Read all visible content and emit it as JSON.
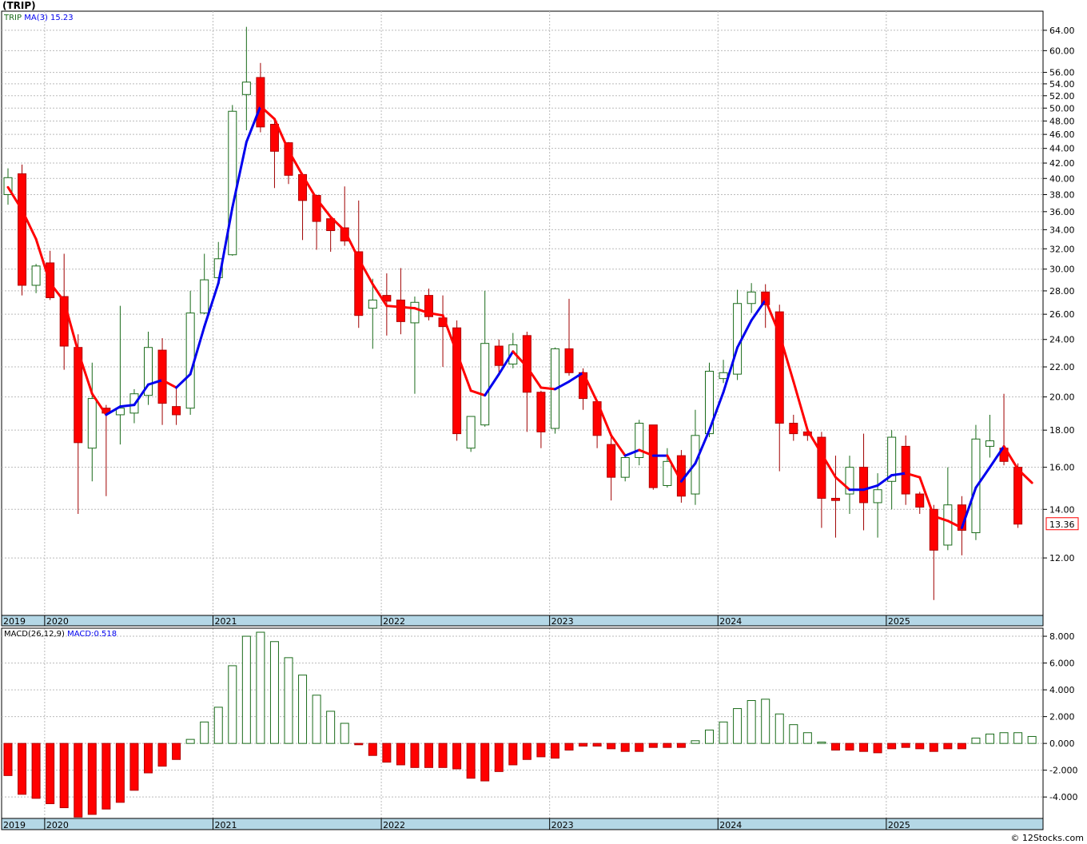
{
  "page": {
    "title": "(TRIP)",
    "credit": "© 12Stocks.com"
  },
  "chart_data": [
    {
      "type": "candlestick",
      "ticker": "TRIP",
      "legend": {
        "ticker_label": "TRIP",
        "ma_label": "MA(3)",
        "ma_value": "15.23"
      },
      "last_price_label": "13.36",
      "colors": {
        "up": "#1a6b1a",
        "down": "#ff0000",
        "ma_up": "#0000ee",
        "ma_down": "#ff0000",
        "axis_bar": "#b4d7e6",
        "grid": "#bbbbbb"
      },
      "y_scale": "log",
      "ylim": [
        10.0,
        68.0
      ],
      "y_ticks": [
        12,
        14,
        16,
        18,
        20,
        22,
        24,
        26,
        28,
        30,
        32,
        34,
        36,
        38,
        40,
        42,
        44,
        46,
        48,
        50,
        52,
        54,
        56,
        60,
        64
      ],
      "y_tick_labels": [
        "12.00",
        "14.00",
        "16.00",
        "18.00",
        "20.00",
        "22.00",
        "24.00",
        "26.00",
        "28.00",
        "30.00",
        "32.00",
        "34.00",
        "36.00",
        "38.00",
        "40.00",
        "42.00",
        "44.00",
        "46.00",
        "48.00",
        "50.00",
        "52.00",
        "54.00",
        "56.00",
        "60.00",
        "64.00"
      ],
      "x_labels": [
        "2019",
        "2020",
        "2021",
        "2022",
        "2023",
        "2024",
        "2025"
      ],
      "x_label_month_index": [
        0,
        3,
        15,
        27,
        39,
        51,
        63
      ],
      "months": [
        "2019-10",
        "2019-11",
        "2019-12",
        "2020-01",
        "2020-02",
        "2020-03",
        "2020-04",
        "2020-05",
        "2020-06",
        "2020-07",
        "2020-08",
        "2020-09",
        "2020-10",
        "2020-11",
        "2020-12",
        "2021-01",
        "2021-02",
        "2021-03",
        "2021-04",
        "2021-05",
        "2021-06",
        "2021-07",
        "2021-08",
        "2021-09",
        "2021-10",
        "2021-11",
        "2021-12",
        "2022-01",
        "2022-02",
        "2022-03",
        "2022-04",
        "2022-05",
        "2022-06",
        "2022-07",
        "2022-08",
        "2022-09",
        "2022-10",
        "2022-11",
        "2022-12",
        "2023-01",
        "2023-02",
        "2023-03",
        "2023-04",
        "2023-05",
        "2023-06",
        "2023-07",
        "2023-08",
        "2023-09",
        "2023-10",
        "2023-11",
        "2023-12",
        "2024-01",
        "2024-02",
        "2024-03",
        "2024-04",
        "2024-05",
        "2024-06",
        "2024-07",
        "2024-08",
        "2024-09",
        "2024-10",
        "2024-11",
        "2024-12",
        "2025-01",
        "2025-02",
        "2025-03",
        "2025-04",
        "2025-05",
        "2025-06",
        "2025-07",
        "2025-08",
        "2025-09",
        "2025-10"
      ],
      "candles": [
        {
          "o": 38.0,
          "h": 41.3,
          "l": 36.8,
          "c": 40.1
        },
        {
          "o": 40.6,
          "h": 41.8,
          "l": 27.6,
          "c": 28.5
        },
        {
          "o": 28.5,
          "h": 30.5,
          "l": 27.8,
          "c": 30.3
        },
        {
          "o": 30.6,
          "h": 31.8,
          "l": 27.2,
          "c": 27.4
        },
        {
          "o": 27.5,
          "h": 31.5,
          "l": 21.8,
          "c": 23.5
        },
        {
          "o": 23.4,
          "h": 24.4,
          "l": 13.8,
          "c": 17.3
        },
        {
          "o": 17.0,
          "h": 22.3,
          "l": 15.3,
          "c": 19.9
        },
        {
          "o": 19.3,
          "h": 19.5,
          "l": 14.6,
          "c": 19.0
        },
        {
          "o": 18.9,
          "h": 26.7,
          "l": 17.2,
          "c": 19.3
        },
        {
          "o": 19.0,
          "h": 20.5,
          "l": 18.4,
          "c": 20.2
        },
        {
          "o": 20.1,
          "h": 24.6,
          "l": 19.5,
          "c": 23.4
        },
        {
          "o": 23.2,
          "h": 24.1,
          "l": 18.3,
          "c": 19.6
        },
        {
          "o": 19.4,
          "h": 20.7,
          "l": 18.3,
          "c": 18.9
        },
        {
          "o": 19.3,
          "h": 28.0,
          "l": 18.9,
          "c": 26.1
        },
        {
          "o": 26.1,
          "h": 31.5,
          "l": 26.0,
          "c": 29.0
        },
        {
          "o": 29.2,
          "h": 32.7,
          "l": 28.7,
          "c": 31.0
        },
        {
          "o": 31.4,
          "h": 50.5,
          "l": 31.3,
          "c": 49.5
        },
        {
          "o": 52.2,
          "h": 64.7,
          "l": 46.6,
          "c": 54.3
        },
        {
          "o": 55.1,
          "h": 57.7,
          "l": 46.3,
          "c": 47.1
        },
        {
          "o": 47.5,
          "h": 48.5,
          "l": 38.8,
          "c": 43.6
        },
        {
          "o": 44.8,
          "h": 44.9,
          "l": 39.3,
          "c": 40.4
        },
        {
          "o": 40.5,
          "h": 40.7,
          "l": 32.9,
          "c": 37.3
        },
        {
          "o": 37.9,
          "h": 38.0,
          "l": 31.9,
          "c": 34.9
        },
        {
          "o": 35.2,
          "h": 35.3,
          "l": 31.7,
          "c": 33.9
        },
        {
          "o": 34.2,
          "h": 39.0,
          "l": 32.3,
          "c": 32.8
        },
        {
          "o": 31.7,
          "h": 37.3,
          "l": 24.9,
          "c": 25.9
        },
        {
          "o": 26.5,
          "h": 29.1,
          "l": 23.3,
          "c": 27.2
        },
        {
          "o": 27.6,
          "h": 29.6,
          "l": 24.3,
          "c": 27.1
        },
        {
          "o": 27.2,
          "h": 30.1,
          "l": 24.4,
          "c": 25.4
        },
        {
          "o": 25.3,
          "h": 27.5,
          "l": 20.2,
          "c": 27.0
        },
        {
          "o": 27.6,
          "h": 28.2,
          "l": 25.5,
          "c": 25.8
        },
        {
          "o": 25.7,
          "h": 27.6,
          "l": 22.0,
          "c": 25.0
        },
        {
          "o": 24.9,
          "h": 25.5,
          "l": 17.4,
          "c": 17.8
        },
        {
          "o": 17.0,
          "h": 18.8,
          "l": 16.8,
          "c": 18.8
        },
        {
          "o": 18.3,
          "h": 28.0,
          "l": 18.2,
          "c": 23.7
        },
        {
          "o": 23.5,
          "h": 24.0,
          "l": 21.5,
          "c": 22.1
        },
        {
          "o": 22.2,
          "h": 24.5,
          "l": 21.9,
          "c": 23.6
        },
        {
          "o": 24.3,
          "h": 24.6,
          "l": 17.9,
          "c": 20.3
        },
        {
          "o": 20.3,
          "h": 20.4,
          "l": 17.0,
          "c": 17.9
        },
        {
          "o": 18.1,
          "h": 23.4,
          "l": 17.8,
          "c": 23.3
        },
        {
          "o": 23.3,
          "h": 27.3,
          "l": 21.4,
          "c": 21.6
        },
        {
          "o": 21.6,
          "h": 21.9,
          "l": 19.2,
          "c": 19.9
        },
        {
          "o": 19.7,
          "h": 19.8,
          "l": 17.0,
          "c": 17.7
        },
        {
          "o": 17.2,
          "h": 17.8,
          "l": 14.4,
          "c": 15.5
        },
        {
          "o": 15.5,
          "h": 16.7,
          "l": 15.3,
          "c": 16.5
        },
        {
          "o": 16.5,
          "h": 18.6,
          "l": 16.1,
          "c": 18.4
        },
        {
          "o": 18.3,
          "h": 18.3,
          "l": 14.9,
          "c": 15.0
        },
        {
          "o": 15.1,
          "h": 17.0,
          "l": 15.0,
          "c": 16.3
        },
        {
          "o": 16.6,
          "h": 16.9,
          "l": 14.3,
          "c": 14.6
        },
        {
          "o": 14.7,
          "h": 19.2,
          "l": 14.2,
          "c": 17.7
        },
        {
          "o": 17.8,
          "h": 22.3,
          "l": 17.6,
          "c": 21.7
        },
        {
          "o": 21.2,
          "h": 22.5,
          "l": 20.9,
          "c": 21.6
        },
        {
          "o": 21.5,
          "h": 28.1,
          "l": 21.1,
          "c": 26.9
        },
        {
          "o": 26.9,
          "h": 28.7,
          "l": 26.1,
          "c": 27.9
        },
        {
          "o": 27.9,
          "h": 28.6,
          "l": 24.9,
          "c": 26.8
        },
        {
          "o": 26.2,
          "h": 26.8,
          "l": 15.8,
          "c": 18.4
        },
        {
          "o": 18.4,
          "h": 18.9,
          "l": 17.4,
          "c": 17.8
        },
        {
          "o": 17.9,
          "h": 18.1,
          "l": 17.4,
          "c": 17.7
        },
        {
          "o": 17.6,
          "h": 17.9,
          "l": 13.2,
          "c": 14.5
        },
        {
          "o": 14.5,
          "h": 16.6,
          "l": 12.8,
          "c": 14.4
        },
        {
          "o": 14.7,
          "h": 16.6,
          "l": 13.8,
          "c": 16.0
        },
        {
          "o": 16.0,
          "h": 17.8,
          "l": 13.1,
          "c": 14.3
        },
        {
          "o": 14.3,
          "h": 15.7,
          "l": 12.8,
          "c": 14.9
        },
        {
          "o": 15.3,
          "h": 18.0,
          "l": 14.0,
          "c": 17.6
        },
        {
          "o": 17.1,
          "h": 17.7,
          "l": 14.2,
          "c": 14.7
        },
        {
          "o": 14.7,
          "h": 14.8,
          "l": 13.8,
          "c": 14.1
        },
        {
          "o": 14.0,
          "h": 14.2,
          "l": 10.5,
          "c": 12.3
        },
        {
          "o": 12.5,
          "h": 16.0,
          "l": 12.3,
          "c": 14.2
        },
        {
          "o": 14.2,
          "h": 14.6,
          "l": 12.1,
          "c": 13.1
        },
        {
          "o": 13.0,
          "h": 18.3,
          "l": 12.7,
          "c": 17.5
        },
        {
          "o": 17.1,
          "h": 18.9,
          "l": 16.5,
          "c": 17.4
        },
        {
          "o": 17.0,
          "h": 20.2,
          "l": 16.1,
          "c": 16.3
        },
        {
          "o": 16.0,
          "h": 16.2,
          "l": 13.2,
          "c": 13.36
        }
      ],
      "ma3": [
        38.9,
        36.2,
        33.0,
        28.7,
        27.1,
        23.1,
        20.2,
        18.9,
        19.4,
        19.5,
        20.8,
        21.1,
        20.6,
        21.5,
        25.0,
        28.7,
        36.5,
        44.9,
        50.3,
        48.3,
        43.7,
        40.4,
        37.5,
        35.4,
        33.9,
        31.0,
        28.6,
        26.7,
        26.6,
        26.5,
        26.1,
        25.9,
        23.0,
        20.4,
        20.1,
        21.5,
        23.1,
        22.0,
        20.6,
        20.5,
        21.0,
        21.6,
        19.7,
        17.7,
        16.6,
        16.9,
        16.6,
        16.6,
        15.3,
        16.2,
        18.0,
        20.3,
        23.4,
        25.5,
        27.2,
        24.4,
        21.0,
        18.0,
        16.7,
        15.5,
        14.9,
        14.9,
        15.1,
        15.6,
        15.7,
        15.5,
        13.7,
        13.5,
        13.2,
        15.0,
        16.0,
        17.1,
        15.9,
        15.23
      ],
      "ma3_note": "rendered as trend-colored line",
      "ma3_trend": [],
      "sub_chart": {
        "type": "histogram",
        "legend": {
          "label": "MACD(26,12,9)",
          "value_label": "MACD:0.518"
        },
        "ylim": [
          -5.6,
          8.6
        ],
        "y_ticks": [
          -4,
          -2,
          0,
          2,
          4,
          6,
          8
        ],
        "y_tick_labels": [
          "-4.000",
          "-2.000",
          "0.000",
          "2.000",
          "4.000",
          "6.000",
          "8.000"
        ],
        "values": [
          -2.4,
          -3.8,
          -4.1,
          -4.5,
          -4.8,
          -5.5,
          -5.3,
          -4.9,
          -4.4,
          -3.5,
          -2.2,
          -1.7,
          -1.2,
          0.3,
          1.6,
          2.7,
          5.8,
          8.0,
          8.3,
          7.6,
          6.4,
          5.1,
          3.6,
          2.4,
          1.5,
          -0.1,
          -0.9,
          -1.4,
          -1.6,
          -1.8,
          -1.8,
          -1.8,
          -1.9,
          -2.6,
          -2.8,
          -2.1,
          -1.6,
          -1.2,
          -1.0,
          -1.1,
          -0.5,
          -0.2,
          -0.2,
          -0.4,
          -0.6,
          -0.6,
          -0.3,
          -0.3,
          -0.3,
          0.2,
          1.0,
          1.6,
          2.6,
          3.2,
          3.3,
          2.2,
          1.4,
          0.8,
          0.1,
          -0.5,
          -0.5,
          -0.6,
          -0.7,
          -0.4,
          -0.3,
          -0.4,
          -0.6,
          -0.4,
          -0.4,
          0.4,
          0.7,
          0.8,
          0.8,
          0.518
        ]
      }
    }
  ]
}
